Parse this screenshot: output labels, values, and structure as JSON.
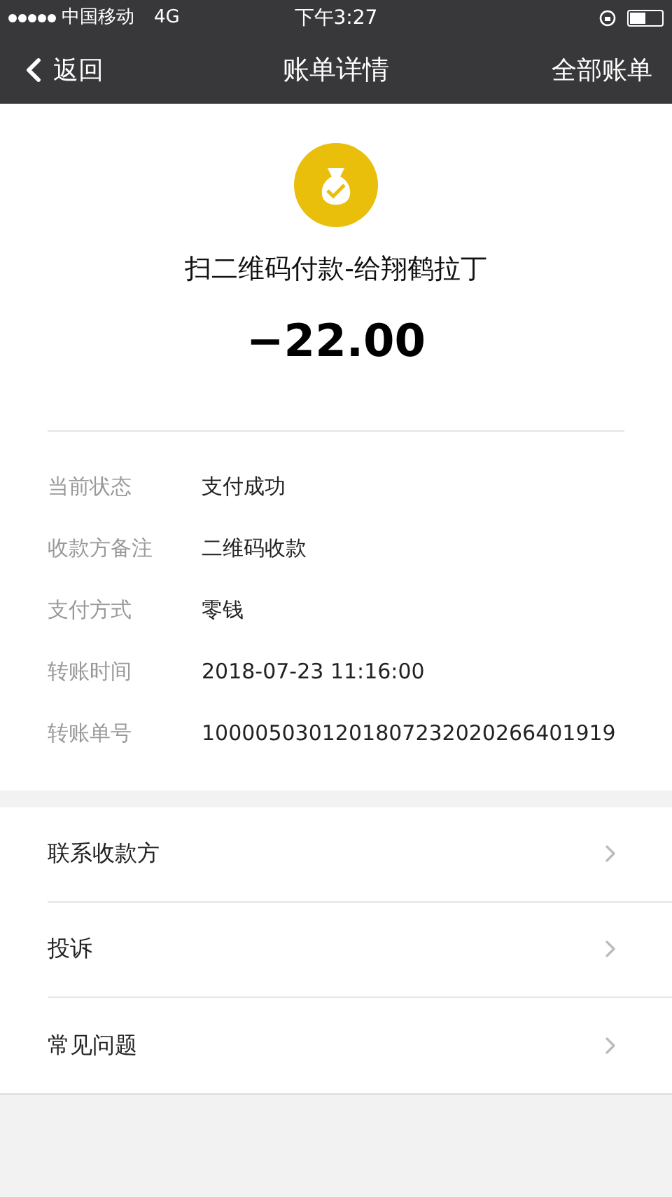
{
  "status_bar": {
    "carrier": "中国移动",
    "network": "4G",
    "time": "下午3:27"
  },
  "nav": {
    "back": "返回",
    "title": "账单详情",
    "action": "全部账单"
  },
  "summary": {
    "title": "扫二维码付款-给翔鹤拉丁",
    "amount": "−22.00"
  },
  "details": [
    {
      "label": "当前状态",
      "value": "支付成功"
    },
    {
      "label": "收款方备注",
      "value": "二维码收款"
    },
    {
      "label": "支付方式",
      "value": "零钱"
    },
    {
      "label": "转账时间",
      "value": "2018-07-23 11:16:00"
    },
    {
      "label": "转账单号",
      "value": "1000050301201807232020266401919"
    }
  ],
  "menu": [
    {
      "label": "联系收款方"
    },
    {
      "label": "投诉"
    },
    {
      "label": "常见问题"
    }
  ]
}
